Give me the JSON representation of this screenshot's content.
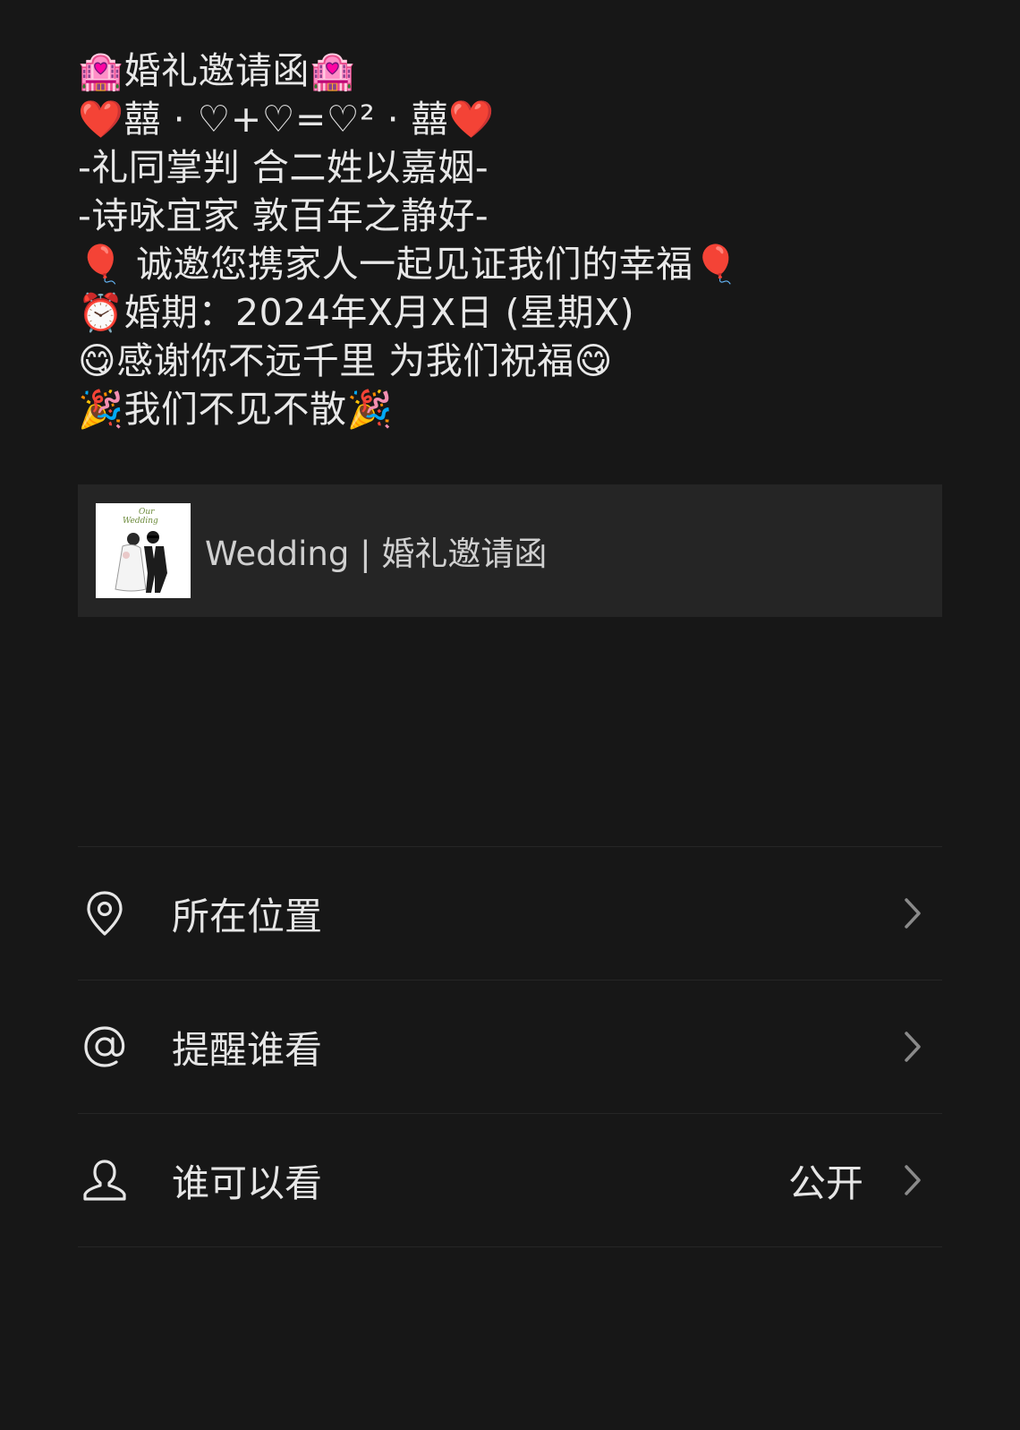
{
  "post": {
    "lines": [
      "🏩婚礼邀请函🏩",
      "❤️囍 · ♡+♡=♡² · 囍❤️",
      "-礼同掌判 合二姓以嘉姻-",
      "-诗咏宜家 敦百年之静好-",
      "🎈 诚邀您携家人一起见证我们的幸福🎈",
      "⏰婚期：2024年X月X日 (星期X)",
      "😋感谢你不远千里 为我们祝福😋",
      "🎉我们不见不散🎉"
    ]
  },
  "link_card": {
    "title": "Wedding | 婚礼邀请函",
    "thumbnail_text": "Our Wedding",
    "thumbnail_icon": "wedding-couple-illustration"
  },
  "options": [
    {
      "label": "所在位置",
      "value": "",
      "icon": "location-pin-icon"
    },
    {
      "label": "提醒谁看",
      "value": "",
      "icon": "at-sign-icon"
    },
    {
      "label": "谁可以看",
      "value": "公开",
      "icon": "person-icon"
    }
  ],
  "colors": {
    "background": "#171717",
    "card": "#252525",
    "text": "#e6e6e6",
    "divider": "#262626"
  }
}
